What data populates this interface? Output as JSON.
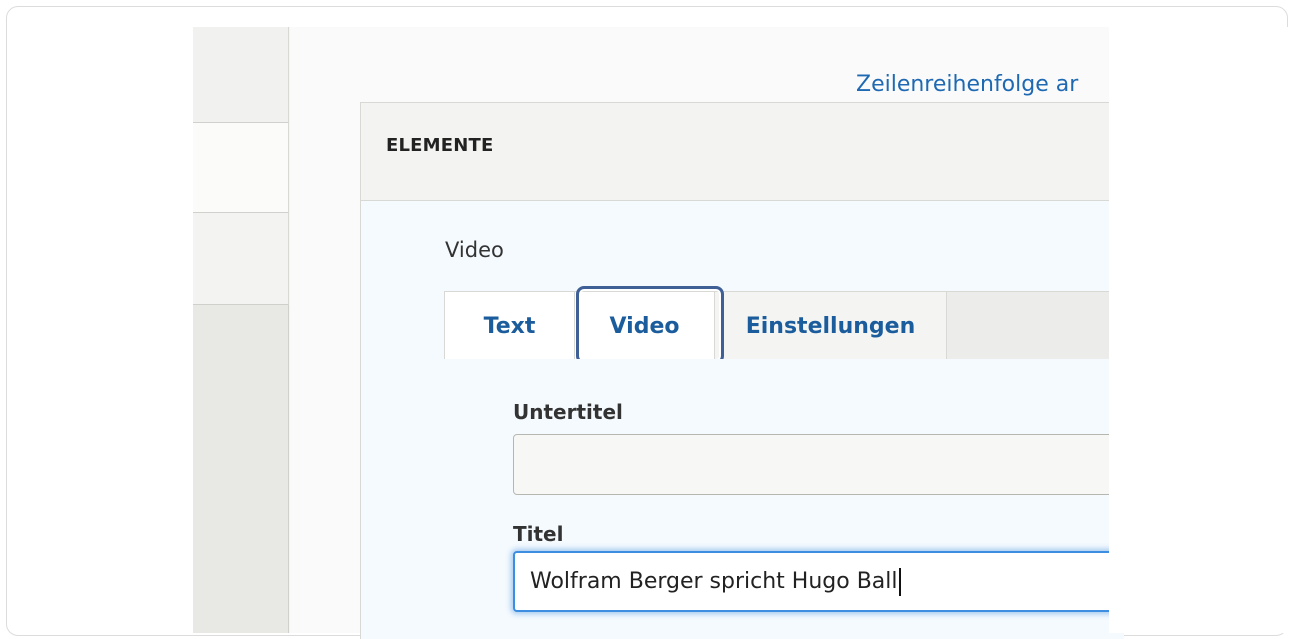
{
  "links": {
    "reorder": "Zeilenreihenfolge ar"
  },
  "panel": {
    "title": "ELEMENTE",
    "paragraph_type": "Video"
  },
  "tabs": [
    {
      "label": "Text",
      "active": false
    },
    {
      "label": "Video",
      "active": true
    },
    {
      "label": "Einstellungen",
      "active": false
    }
  ],
  "fields": {
    "subtitle": {
      "label": "Untertitel",
      "value": ""
    },
    "title": {
      "label": "Titel",
      "value": "Wolfram Berger spricht Hugo Ball"
    }
  },
  "colors": {
    "link": "#1f69b3",
    "tab_text": "#1b5c9c",
    "focus_ring": "#3d8de0",
    "highlight_frame": "#3f5f97"
  }
}
